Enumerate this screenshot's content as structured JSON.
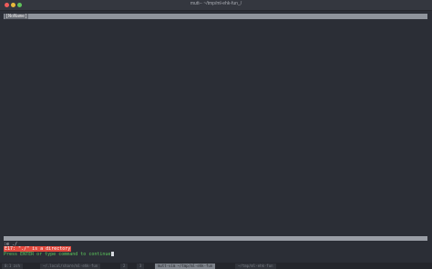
{
  "window": {
    "title": "mutt-- ~/tmp/ml-ehk-fun_/"
  },
  "vim": {
    "tab_label": "[NoName]",
    "cmdline": ":e ./",
    "error_message": "E17: \"./\" is a directory",
    "prompt_message": "Press ENTER or type command to continue"
  },
  "tmux": {
    "windows": [
      {
        "label": "0:1  zsh"
      },
      {
        "label": "~/.local/share/ml-ehk-fun"
      },
      {
        "label": "2"
      },
      {
        "label": "3"
      },
      {
        "label": "mutt-vim ~/tmp/ml-ehk-fun"
      },
      {
        "label": "~/tmp/ml-ehk-fun"
      }
    ]
  },
  "colors": {
    "error_bg": "#e24a3f",
    "prompt_fg": "#5cc85c",
    "editor_bg": "#2b2e36"
  }
}
